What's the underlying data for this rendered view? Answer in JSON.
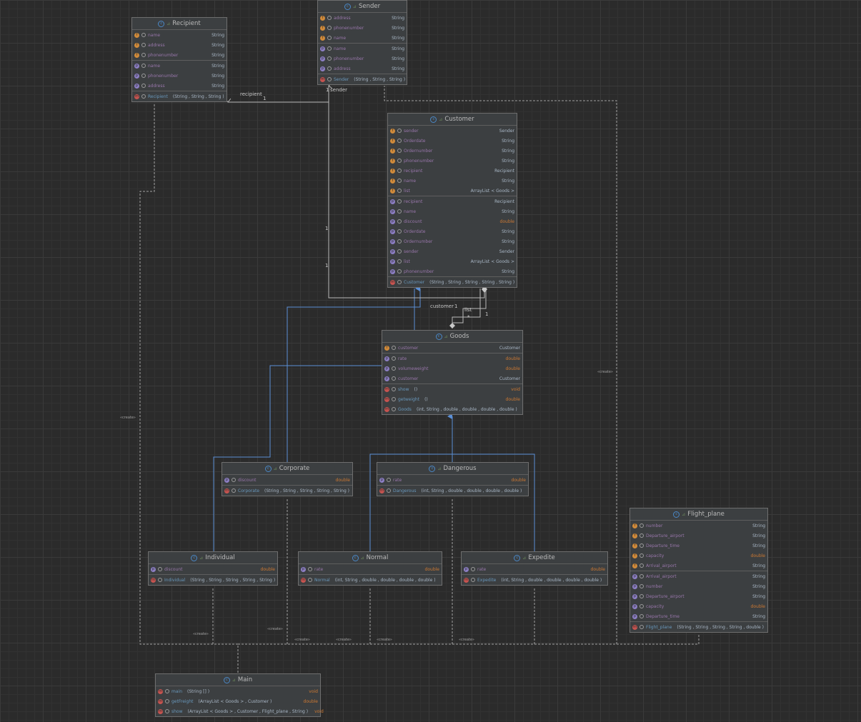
{
  "classes": [
    {
      "id": "recipient",
      "name": "Recipient",
      "fields": [
        {
          "v": "f",
          "n": "name",
          "t": "String"
        },
        {
          "v": "f",
          "n": "address",
          "t": "String"
        },
        {
          "v": "f",
          "n": "phonenumber",
          "t": "String"
        }
      ],
      "props": [
        {
          "v": "p",
          "n": "name",
          "t": "String"
        },
        {
          "v": "p",
          "n": "phonenumber",
          "t": "String"
        },
        {
          "v": "p",
          "n": "address",
          "t": "String"
        }
      ],
      "methods": [
        {
          "v": "m",
          "n": "Recipient",
          "a": "(String , String , String )",
          "t": ""
        }
      ]
    },
    {
      "id": "sender",
      "name": "Sender",
      "fields": [
        {
          "v": "f",
          "n": "address",
          "t": "String"
        },
        {
          "v": "f",
          "n": "phonenumber",
          "t": "String"
        },
        {
          "v": "f",
          "n": "name",
          "t": "String"
        }
      ],
      "props": [
        {
          "v": "p",
          "n": "name",
          "t": "String"
        },
        {
          "v": "p",
          "n": "phonenumber",
          "t": "String"
        },
        {
          "v": "p",
          "n": "address",
          "t": "String"
        }
      ],
      "methods": [
        {
          "v": "m",
          "n": "Sender",
          "a": "(String , String , String )",
          "t": ""
        }
      ]
    },
    {
      "id": "customer",
      "name": "Customer",
      "fields": [
        {
          "v": "f",
          "n": "sender",
          "t": "Sender"
        },
        {
          "v": "f",
          "n": "Orderdate",
          "t": "String"
        },
        {
          "v": "f",
          "n": "Ordernumber",
          "t": "String"
        },
        {
          "v": "f",
          "n": "phonenumber",
          "t": "String"
        },
        {
          "v": "f",
          "n": "recipient",
          "t": "Recipient"
        },
        {
          "v": "f",
          "n": "name",
          "t": "String"
        },
        {
          "v": "f",
          "n": "list",
          "t": "ArrayList < Goods >"
        }
      ],
      "props": [
        {
          "v": "p",
          "n": "recipient",
          "t": "Recipient"
        },
        {
          "v": "p",
          "n": "name",
          "t": "String"
        },
        {
          "v": "p",
          "n": "discount",
          "t": "double"
        },
        {
          "v": "p",
          "n": "Orderdate",
          "t": "String"
        },
        {
          "v": "p",
          "n": "Ordernumber",
          "t": "String"
        },
        {
          "v": "p",
          "n": "sender",
          "t": "Sender"
        },
        {
          "v": "p",
          "n": "list",
          "t": "ArrayList < Goods >"
        },
        {
          "v": "p",
          "n": "phonenumber",
          "t": "String"
        }
      ],
      "methods": [
        {
          "v": "m",
          "n": "Customer",
          "a": "(String , String , String , String , String )",
          "t": ""
        }
      ]
    },
    {
      "id": "goods",
      "name": "Goods",
      "fields": [
        {
          "v": "f",
          "n": "customer",
          "t": "Customer"
        }
      ],
      "props": [
        {
          "v": "p",
          "n": "rate",
          "t": "double"
        },
        {
          "v": "p",
          "n": "volumeweight",
          "t": "double"
        },
        {
          "v": "p",
          "n": "customer",
          "t": "Customer"
        }
      ],
      "methods": [
        {
          "v": "m",
          "n": "show",
          "a": "()",
          "t": "void"
        },
        {
          "v": "m",
          "n": "getweight",
          "a": "()",
          "t": "double"
        },
        {
          "v": "m",
          "n": "Goods",
          "a": "(int, String , double , double , double , double )",
          "t": ""
        }
      ]
    },
    {
      "id": "corporate",
      "name": "Corporate",
      "fields": [],
      "props": [
        {
          "v": "p",
          "n": "discount",
          "t": "double"
        }
      ],
      "methods": [
        {
          "v": "m",
          "n": "Corporate",
          "a": "(String , String , String , String , String )",
          "t": ""
        }
      ]
    },
    {
      "id": "dangerous",
      "name": "Dangerous",
      "fields": [],
      "props": [
        {
          "v": "p",
          "n": "rate",
          "t": "double"
        }
      ],
      "methods": [
        {
          "v": "m",
          "n": "Dangerous",
          "a": "(int, String , double , double , double , double )",
          "t": ""
        }
      ]
    },
    {
      "id": "individual",
      "name": "Individual",
      "fields": [],
      "props": [
        {
          "v": "p",
          "n": "discount",
          "t": "double"
        }
      ],
      "methods": [
        {
          "v": "m",
          "n": "Individual",
          "a": "(String , String , String , String , String )",
          "t": ""
        }
      ]
    },
    {
      "id": "normal",
      "name": "Normal",
      "fields": [],
      "props": [
        {
          "v": "p",
          "n": "rate",
          "t": "double"
        }
      ],
      "methods": [
        {
          "v": "m",
          "n": "Normal",
          "a": "(int, String , double , double , double , double )",
          "t": ""
        }
      ]
    },
    {
      "id": "expedite",
      "name": "Expedite",
      "fields": [],
      "props": [
        {
          "v": "p",
          "n": "rate",
          "t": "double"
        }
      ],
      "methods": [
        {
          "v": "m",
          "n": "Expedite",
          "a": "(int, String , double , double , double , double )",
          "t": ""
        }
      ]
    },
    {
      "id": "flight_plane",
      "name": "Flight_plane",
      "fields": [
        {
          "v": "f",
          "n": "number",
          "t": "String"
        },
        {
          "v": "f",
          "n": "Departure_airport",
          "t": "String"
        },
        {
          "v": "f",
          "n": "Departure_time",
          "t": "String"
        },
        {
          "v": "f",
          "n": "capacity",
          "t": "double"
        },
        {
          "v": "f",
          "n": "Arrival_airport",
          "t": "String"
        }
      ],
      "props": [
        {
          "v": "p",
          "n": "Arrival_airport",
          "t": "String"
        },
        {
          "v": "p",
          "n": "number",
          "t": "String"
        },
        {
          "v": "p",
          "n": "Departure_airport",
          "t": "String"
        },
        {
          "v": "p",
          "n": "capacity",
          "t": "double"
        },
        {
          "v": "p",
          "n": "Departure_time",
          "t": "String"
        }
      ],
      "methods": [
        {
          "v": "m",
          "n": "Flight_plane",
          "a": "(String , String , String , String , double )",
          "t": ""
        }
      ]
    },
    {
      "id": "main",
      "name": "Main",
      "fields": [],
      "props": [],
      "methods": [
        {
          "v": "s",
          "n": "main",
          "a": "(String [] )",
          "t": "void"
        },
        {
          "v": "s",
          "n": "getFreight",
          "a": "(ArrayList  < Goods > , Customer )",
          "t": "double"
        },
        {
          "v": "s",
          "n": "show",
          "a": "(ArrayList  < Goods > , Customer , Flight_plane , String )",
          "t": "void"
        }
      ]
    }
  ],
  "labels": {
    "recipient": "recipient",
    "recipient_mult": "1",
    "sender": "sender",
    "sender_mult": "1",
    "customer": "customer",
    "customer_mult": "1",
    "list": "list",
    "list_mult": "*",
    "one_a": "1",
    "one_b": "1",
    "one_c": "1",
    "create": "«create»"
  },
  "colors": {
    "inherit": "#5b8fd6",
    "assoc": "#b8b8b8",
    "dashed": "#a0a0a0"
  }
}
